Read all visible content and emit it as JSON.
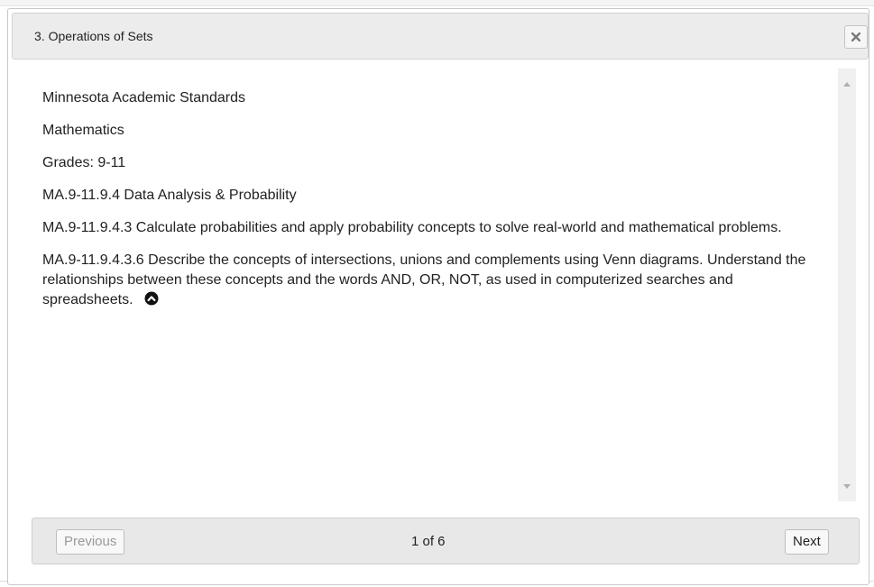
{
  "dialog": {
    "title": "3. Operations of Sets",
    "close_icon": "close-icon"
  },
  "content": {
    "lines": [
      "Minnesota Academic Standards",
      "Mathematics",
      "Grades: 9-11",
      "MA.9-11.9.4 Data Analysis & Probability",
      "MA.9-11.9.4.3 Calculate probabilities and apply probability concepts to solve real-world and mathematical problems.",
      "MA.9-11.9.4.3.6 Describe the concepts of intersections, unions and complements using Venn diagrams. Understand the relationships between these concepts and the words AND, OR, NOT, as used in computerized searches and spreadsheets."
    ],
    "collapse_icon": "chevron-up-circle-icon"
  },
  "footer": {
    "previous_label": "Previous",
    "page_indicator": "1 of 6",
    "next_label": "Next"
  },
  "colors": {
    "titlebar_bg": "#ececec",
    "footer_bg": "#e8e8e8",
    "disabled_text": "#9a9a9a",
    "text": "#222222"
  }
}
